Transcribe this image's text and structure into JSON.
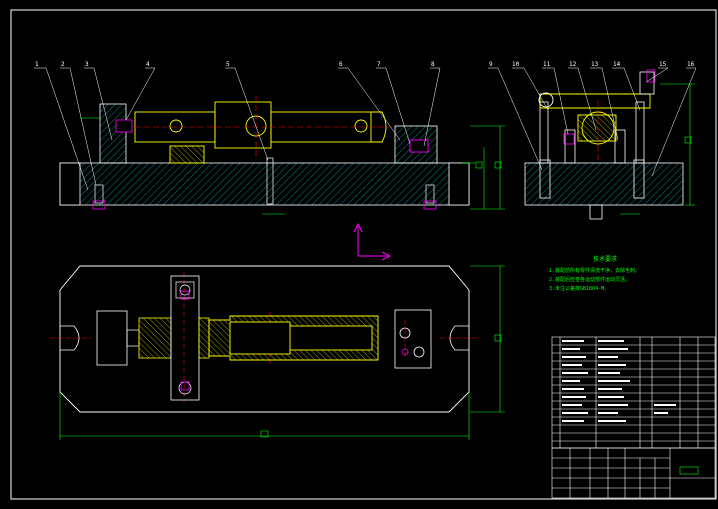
{
  "drawing": {
    "balloon_labels": [
      "1",
      "2",
      "3",
      "4",
      "5",
      "6",
      "7",
      "8",
      "9",
      "10",
      "11",
      "12",
      "13",
      "14",
      "15",
      "16"
    ],
    "notes_title": "技术要求",
    "notes_lines": [
      "1.装配前所有零件清洗干净，去除毛刺。",
      "2.装配后检查各运动部件运动灵活。",
      "3.未注公差按GB1804-M。"
    ],
    "colors": {
      "background": "#000000",
      "outline": "#ffffff",
      "part_yellow": "#ffff00",
      "hatch_cyan": "#00c0c0",
      "dimension_green": "#00ff00",
      "center_red": "#ff0000",
      "datum_magenta": "#ff00ff"
    }
  }
}
